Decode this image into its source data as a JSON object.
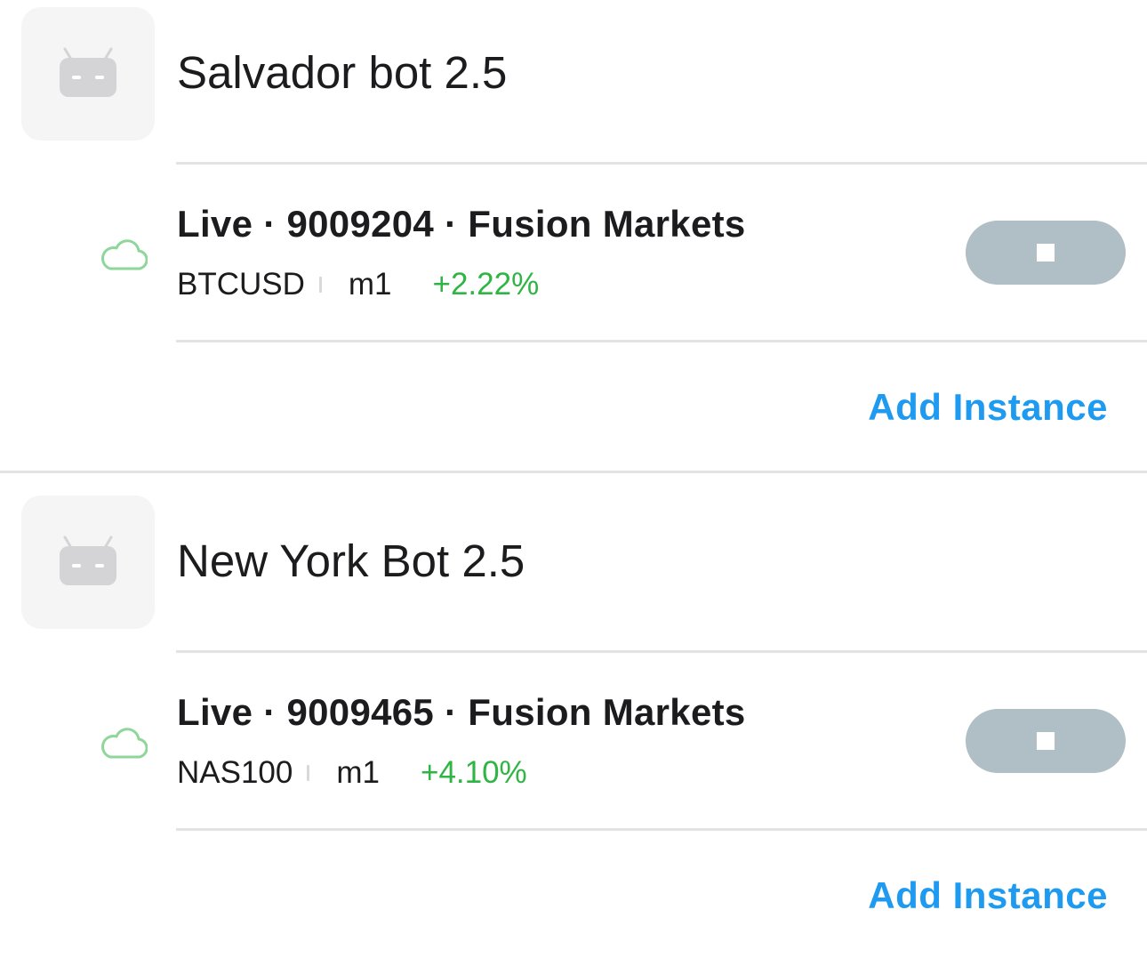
{
  "bots": [
    {
      "name": "Salvador bot 2.5",
      "avatar_icon": "robot-icon",
      "instances": [
        {
          "status_icon": "cloud-icon",
          "title": "Live · 9009204 · Fusion Markets",
          "symbol": "BTCUSD",
          "timeframe": "m1",
          "pnl": "+2.22%",
          "action_icon": "stop-icon"
        }
      ],
      "add_label": "Add Instance"
    },
    {
      "name": "New York Bot 2.5",
      "avatar_icon": "robot-icon",
      "instances": [
        {
          "status_icon": "cloud-icon",
          "title": "Live · 9009465 · Fusion Markets",
          "symbol": "NAS100",
          "timeframe": "m1",
          "pnl": "+4.10%",
          "action_icon": "stop-icon"
        }
      ],
      "add_label": "Add Instance"
    }
  ],
  "colors": {
    "pnl_positive": "#2eb543",
    "link": "#1e9bf0",
    "stop_button": "#b0bec5",
    "cloud": "#8ed69a",
    "robot": "#d4d4d6"
  }
}
